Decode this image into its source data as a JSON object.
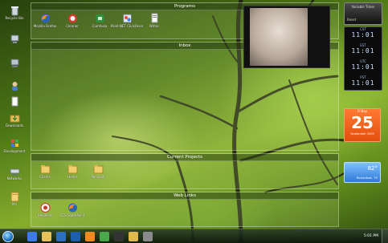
{
  "desktop_icons": [
    {
      "label": "Recycle Bin",
      "icon": "recycle-bin-icon"
    },
    {
      "label": "",
      "icon": "computer-icon"
    },
    {
      "label": "",
      "icon": "network-computer-icon"
    },
    {
      "label": "",
      "icon": "user-folder-icon"
    },
    {
      "label": "",
      "icon": "document-icon"
    },
    {
      "label": "Downloads",
      "icon": "downloads-folder-icon"
    },
    {
      "label": "Development",
      "icon": "development-icon"
    },
    {
      "label": "Networks",
      "icon": "network-icon"
    },
    {
      "label": "Me",
      "icon": "folder-icon"
    }
  ],
  "fences": {
    "programs": {
      "title": "Programs",
      "items": [
        {
          "label": "Mozilla Firefox",
          "icon": "firefox-icon"
        },
        {
          "label": "Cleaner",
          "icon": "ccleaner-icon"
        },
        {
          "label": "Camtasia",
          "icon": "camtasia-icon"
        },
        {
          "label": "Paint.NET ClickOnce",
          "icon": "paintnet-icon"
        },
        {
          "label": "Writer",
          "icon": "writer-icon"
        }
      ]
    },
    "inbox": {
      "title": "Inbox",
      "items": []
    },
    "current_projects": {
      "title": "Current Projects",
      "items": [
        {
          "label": "Clients",
          "icon": "folder-icon"
        },
        {
          "label": "Home",
          "icon": "folder-icon"
        },
        {
          "label": "Personal",
          "icon": "folder-icon"
        }
      ]
    },
    "web_links": {
      "title": "Web Links",
      "items": [
        {
          "label": "Helpdesk",
          "icon": "helpdesk-icon"
        },
        {
          "label": "CCS SharePoint",
          "icon": "firefox-icon"
        }
      ]
    }
  },
  "gadgets": {
    "timer": {
      "title": "Variable Timer",
      "reset": "Reset"
    },
    "clocks": [
      {
        "zone": "CST",
        "time": "11:01"
      },
      {
        "zone": "EST",
        "time": "11:01"
      },
      {
        "zone": "UTC",
        "time": "11:01"
      },
      {
        "zone": "PST",
        "time": "11:01"
      }
    ],
    "calendar": {
      "day": "Friday",
      "date": "25",
      "month": "September 2009"
    },
    "weather": {
      "temp": "82°",
      "city": "Richardson, TX"
    }
  },
  "taskbar": {
    "clock": "5:01 PM",
    "buttons": [
      "ie-icon",
      "explorer-icon",
      "media-player-icon",
      "outlook-icon",
      "firefox-icon",
      "chat-icon",
      "terminal-icon",
      "folder-icon",
      "app-icon"
    ]
  },
  "colors": {
    "fence_fill": "#d2eb96",
    "calendar_orange": "#e24f0c",
    "weather_blue": "#2f78d6"
  }
}
